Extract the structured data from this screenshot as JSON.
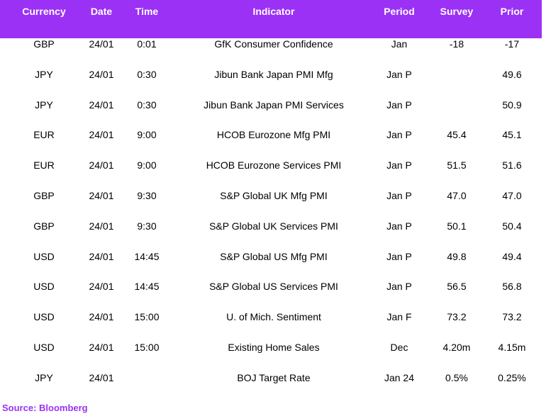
{
  "colors": {
    "header_bg": "#9b31f5",
    "header_text": "#ffffff",
    "source_text": "#9b31f5"
  },
  "table": {
    "headers": {
      "currency": "Currency",
      "date": "Date",
      "time": "Time",
      "indicator": "Indicator",
      "period": "Period",
      "survey": "Survey",
      "prior": "Prior"
    },
    "rows": [
      {
        "currency": "GBP",
        "date": "24/01",
        "time": "0:01",
        "indicator": "GfK Consumer Confidence",
        "period": "Jan",
        "survey": "-18",
        "prior": "-17"
      },
      {
        "currency": "JPY",
        "date": "24/01",
        "time": "0:30",
        "indicator": "Jibun Bank Japan PMI Mfg",
        "period": "Jan P",
        "survey": "",
        "prior": "49.6"
      },
      {
        "currency": "JPY",
        "date": "24/01",
        "time": "0:30",
        "indicator": "Jibun Bank Japan PMI Services",
        "period": "Jan P",
        "survey": "",
        "prior": "50.9"
      },
      {
        "currency": "EUR",
        "date": "24/01",
        "time": "9:00",
        "indicator": "HCOB Eurozone Mfg PMI",
        "period": "Jan P",
        "survey": "45.4",
        "prior": "45.1"
      },
      {
        "currency": "EUR",
        "date": "24/01",
        "time": "9:00",
        "indicator": "HCOB Eurozone Services PMI",
        "period": "Jan P",
        "survey": "51.5",
        "prior": "51.6"
      },
      {
        "currency": "GBP",
        "date": "24/01",
        "time": "9:30",
        "indicator": "S&P Global UK Mfg PMI",
        "period": "Jan P",
        "survey": "47.0",
        "prior": "47.0"
      },
      {
        "currency": "GBP",
        "date": "24/01",
        "time": "9:30",
        "indicator": "S&P Global UK Services PMI",
        "period": "Jan P",
        "survey": "50.1",
        "prior": "50.4"
      },
      {
        "currency": "USD",
        "date": "24/01",
        "time": "14:45",
        "indicator": "S&P Global US Mfg PMI",
        "period": "Jan P",
        "survey": "49.8",
        "prior": "49.4"
      },
      {
        "currency": "USD",
        "date": "24/01",
        "time": "14:45",
        "indicator": "S&P Global US Services PMI",
        "period": "Jan P",
        "survey": "56.5",
        "prior": "56.8"
      },
      {
        "currency": "USD",
        "date": "24/01",
        "time": "15:00",
        "indicator": "U. of Mich. Sentiment",
        "period": "Jan F",
        "survey": "73.2",
        "prior": "73.2"
      },
      {
        "currency": "USD",
        "date": "24/01",
        "time": "15:00",
        "indicator": "Existing Home Sales",
        "period": "Dec",
        "survey": "4.20m",
        "prior": "4.15m"
      },
      {
        "currency": "JPY",
        "date": "24/01",
        "time": "",
        "indicator": "BOJ Target Rate",
        "period": "Jan 24",
        "survey": "0.5%",
        "prior": "0.25%"
      }
    ]
  },
  "source": "Source: Bloomberg"
}
